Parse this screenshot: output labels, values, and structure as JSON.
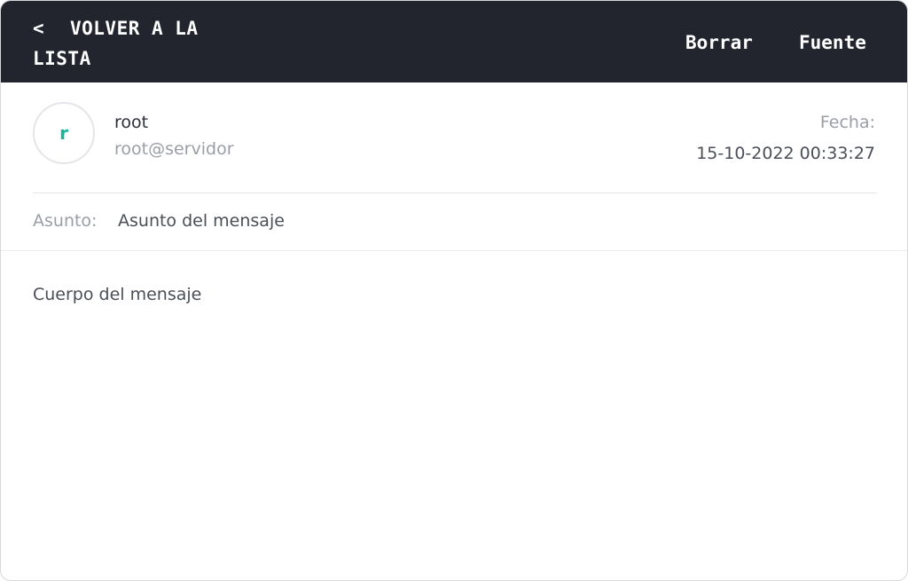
{
  "header": {
    "back_icon": "<",
    "back_label": "VOLVER A LA LISTA",
    "delete_label": "Borrar",
    "source_label": "Fuente",
    "background_color": "#22252d"
  },
  "message": {
    "avatar_letter": "r",
    "avatar_color": "#19b39c",
    "sender_name": "root",
    "sender_email": "root@servidor",
    "date_label": "Fecha:",
    "date_value": "15-10-2022 00:33:27",
    "subject_label": "Asunto:",
    "subject_value": "Asunto del mensaje",
    "body": "Cuerpo del mensaje"
  }
}
